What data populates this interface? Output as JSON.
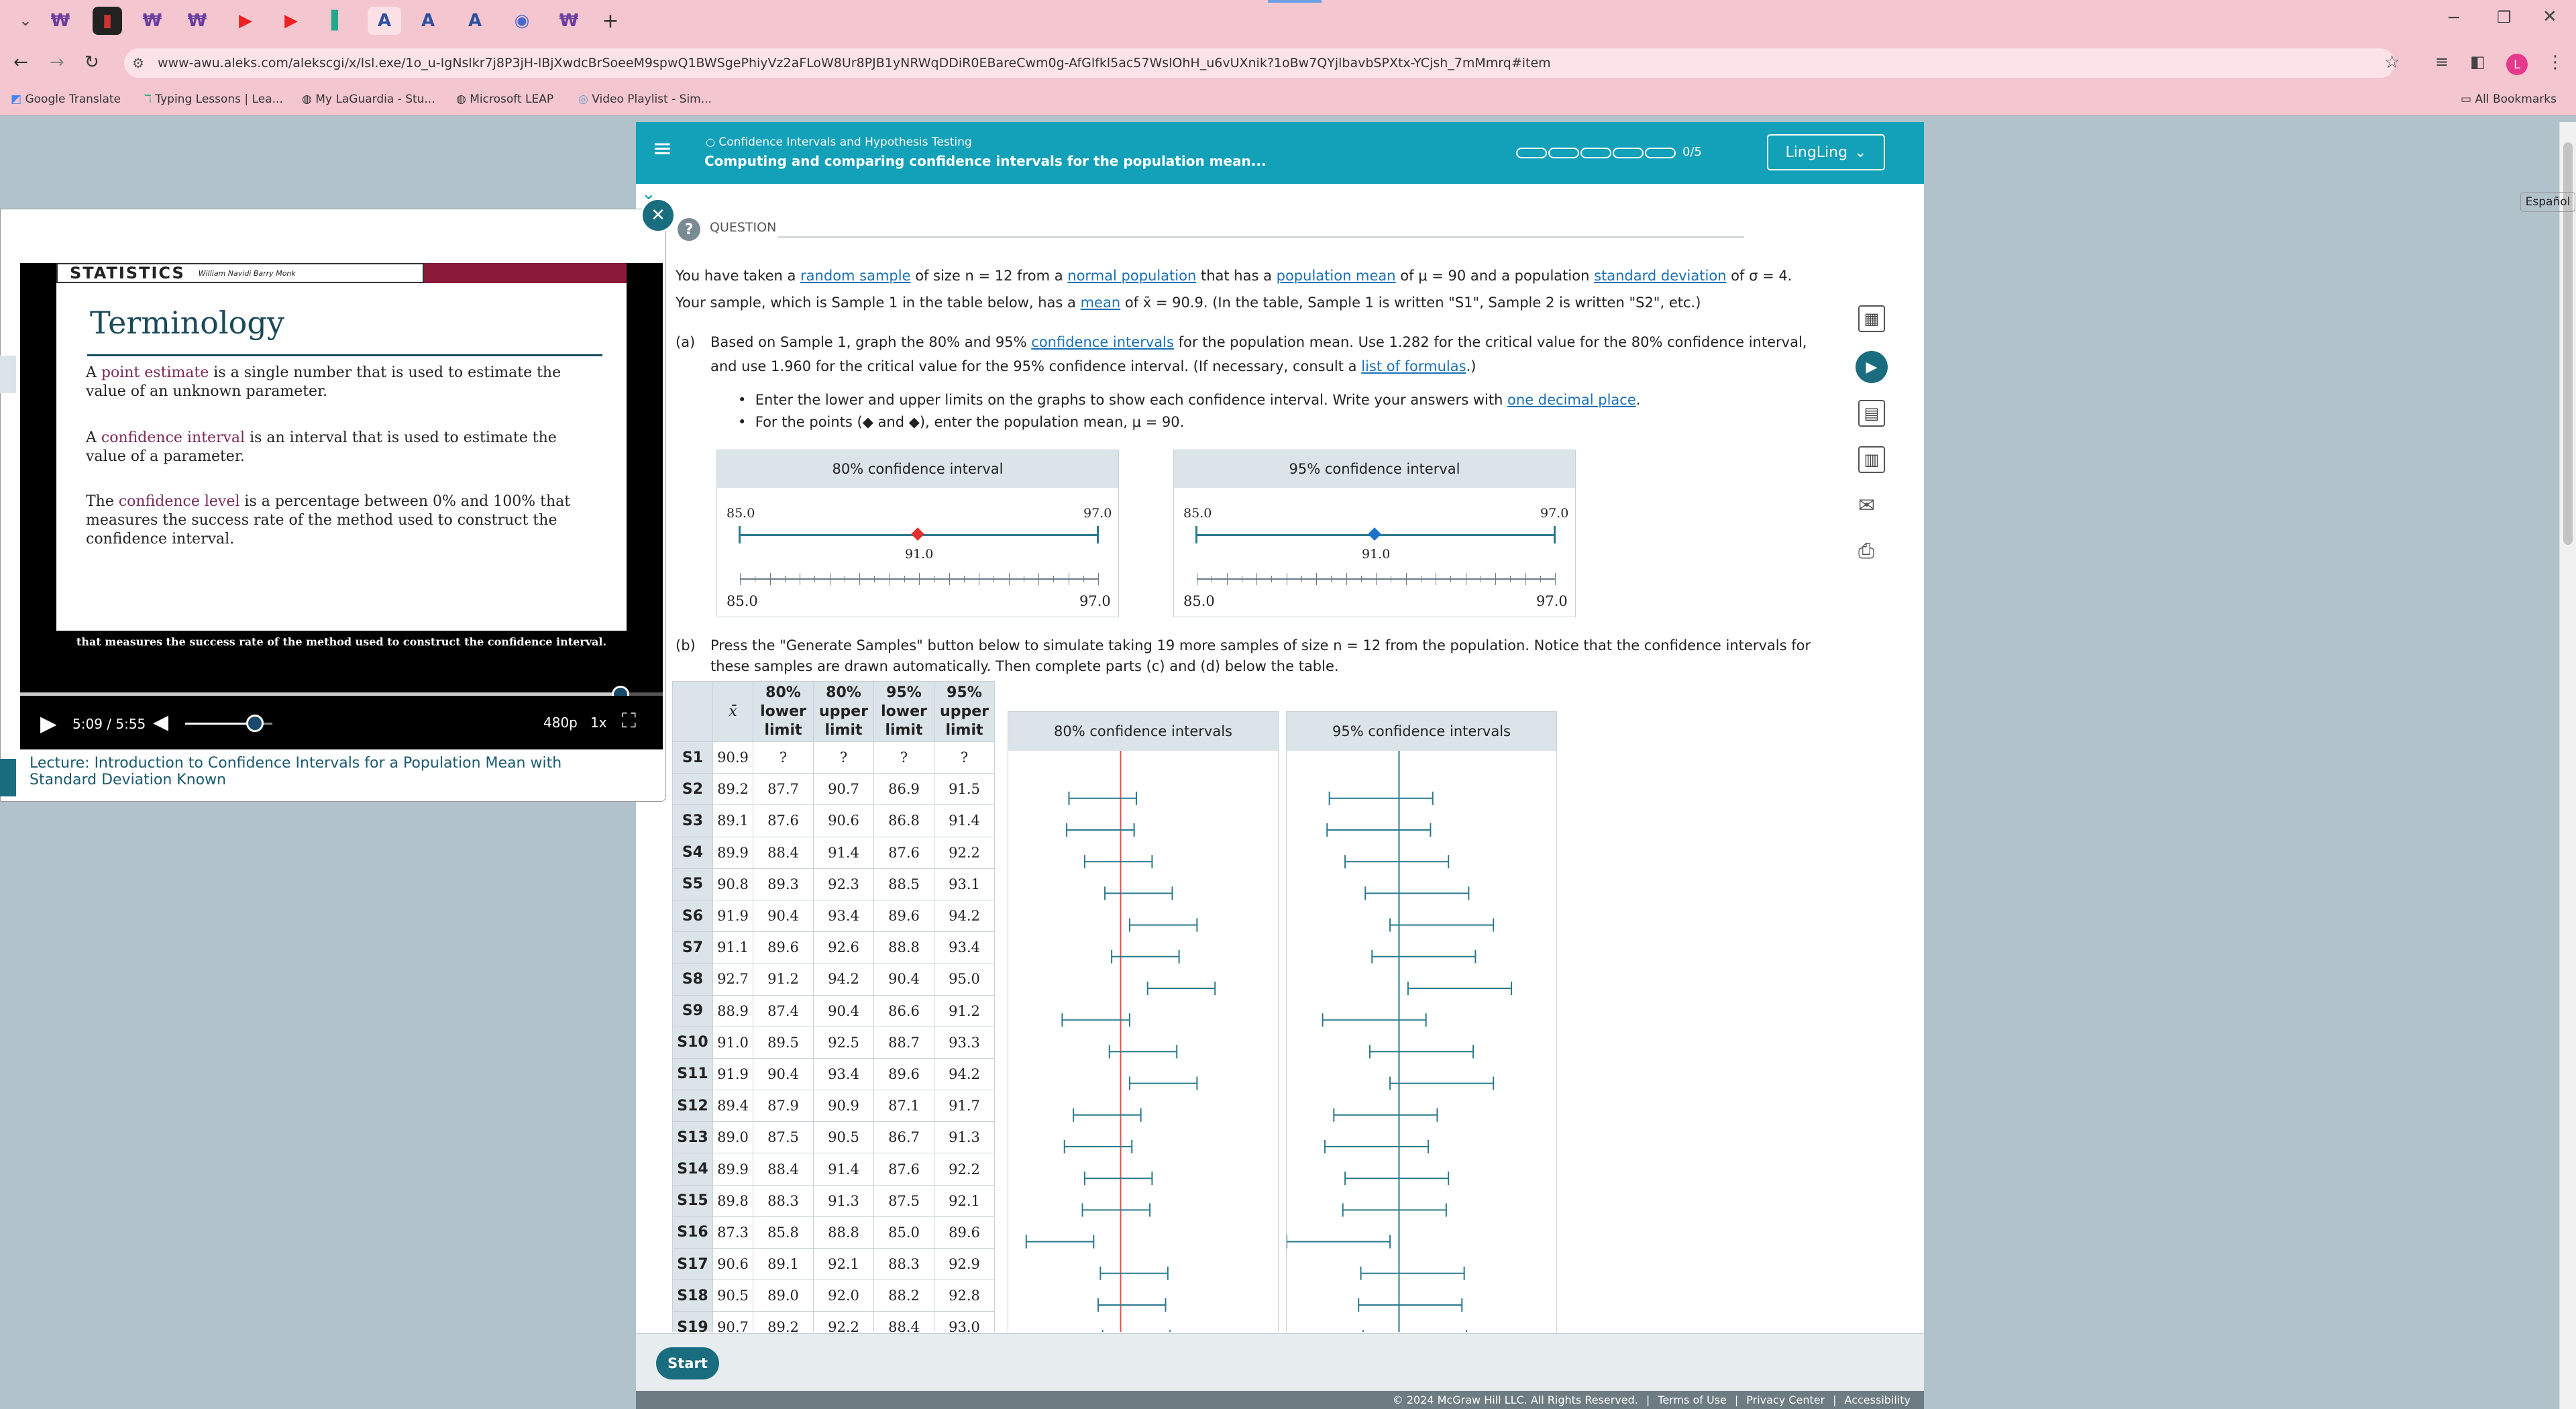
{
  "browser": {
    "url": "www-awu.aleks.com/alekscgi/x/Isl.exe/1o_u-IgNslkr7j8P3jH-lBjXwdcBrSoeeM9spwQ1BWSgePhiyVz2aFLoW8Ur8PJB1yNRWqDDiR0EBareCwm0g-AfGlfkl5ac57WslOhH_u6vUXnik?1oBw7QYjlbavbSPXtx-YCjsh_7mMmrq#item",
    "bookmarks": [
      "Google Translate",
      "Typing Lessons | Lea...",
      "My LaGuardia - Stu...",
      "Microsoft LEAP",
      "Video Playlist - Sim..."
    ],
    "all_bookmarks": "All Bookmarks",
    "profile_initial": "L",
    "tab_letters": [
      "A",
      "A",
      "A"
    ]
  },
  "video": {
    "book_title": "STATISTICS",
    "authors": "William Navidi  Barry Monk",
    "slide_heading": "Terminology",
    "slide_p1_a": "A ",
    "slide_p1_term": "point estimate",
    "slide_p1_b": " is a single number that is used to estimate the value of an unknown parameter.",
    "slide_p2_a": "A ",
    "slide_p2_term": "confidence interval",
    "slide_p2_b": " is an interval that is used to estimate the value of a parameter.",
    "slide_p3_a": "The ",
    "slide_p3_term": "confidence level",
    "slide_p3_b": " is a percentage between 0% and 100% that measures the success rate of the method used to construct the confidence interval.",
    "caption": "that measures the success rate of the method used to construct the confidence interval.",
    "time": "5:09 / 5:55",
    "quality": "480p",
    "speed": "1x",
    "progress": 0.934,
    "volume": 0.8,
    "lecture_title": "Lecture: Introduction to Confidence Intervals for a Population Mean with Standard Deviation Known"
  },
  "header": {
    "topic": "Confidence Intervals and Hypothesis Testing",
    "subtitle": "Computing and comparing confidence intervals for the population mean...",
    "progress_text": "0/5",
    "user": "LingLing",
    "espanol": "Español",
    "question_label": "QUESTION"
  },
  "question": {
    "intro1": [
      "You have taken a ",
      "random sample",
      " of size n = 12 from a ",
      "normal population",
      " that has a ",
      "population mean",
      " of μ = 90 and a population ",
      "standard deviation",
      " of σ = 4."
    ],
    "intro2": [
      "Your sample, which is Sample 1 in the table below, has a ",
      "mean",
      " of x̄ = 90.9. (In the table, Sample 1 is written \"S1\", Sample 2 is written \"S2\", etc.)"
    ],
    "a_label": "(a)",
    "a1": [
      "Based on Sample 1, graph the 80% and 95% ",
      "confidence intervals",
      " for the population mean. Use 1.282 for the critical value for the 80% confidence interval,"
    ],
    "a2": [
      "and use 1.960 for the critical value for the 95% confidence interval. (If necessary, consult a ",
      "list of formulas",
      ".)"
    ],
    "bullet1": [
      "Enter the lower and upper limits on the graphs to show each confidence interval. Write your answers with ",
      "one decimal place",
      "."
    ],
    "bullet2": "For the points (◆ and ◆), enter the population mean, μ = 90.",
    "b_label": "(b)",
    "b1": "Press the \"Generate Samples\" button below to simulate taking 19 more samples of size n = 12 from the population. Notice that the confidence intervals for",
    "b2": "these samples are drawn automatically. Then complete parts (c) and (d) below the table."
  },
  "graph80": {
    "title": "80% confidence interval",
    "left": "85.0",
    "right": "97.0",
    "mid": "91.0",
    "axis_left": "85.0",
    "axis_right": "97.0"
  },
  "graph95": {
    "title": "95% confidence interval",
    "left": "85.0",
    "right": "97.0",
    "mid": "91.0",
    "axis_left": "85.0",
    "axis_right": "97.0"
  },
  "table": {
    "headers": [
      "x̄",
      "80% lower limit",
      "80% upper limit",
      "95% lower limit",
      "95% upper limit"
    ],
    "col80": "80% confidence intervals",
    "col95": "95% confidence intervals",
    "mu": 90,
    "xmin": 85,
    "xmax": 97,
    "rows": [
      [
        "S1",
        "90.9",
        "?",
        "?",
        "?",
        "?"
      ],
      [
        "S2",
        "89.2",
        "87.7",
        "90.7",
        "86.9",
        "91.5"
      ],
      [
        "S3",
        "89.1",
        "87.6",
        "90.6",
        "86.8",
        "91.4"
      ],
      [
        "S4",
        "89.9",
        "88.4",
        "91.4",
        "87.6",
        "92.2"
      ],
      [
        "S5",
        "90.8",
        "89.3",
        "92.3",
        "88.5",
        "93.1"
      ],
      [
        "S6",
        "91.9",
        "90.4",
        "93.4",
        "89.6",
        "94.2"
      ],
      [
        "S7",
        "91.1",
        "89.6",
        "92.6",
        "88.8",
        "93.4"
      ],
      [
        "S8",
        "92.7",
        "91.2",
        "94.2",
        "90.4",
        "95.0"
      ],
      [
        "S9",
        "88.9",
        "87.4",
        "90.4",
        "86.6",
        "91.2"
      ],
      [
        "S10",
        "91.0",
        "89.5",
        "92.5",
        "88.7",
        "93.3"
      ],
      [
        "S11",
        "91.9",
        "90.4",
        "93.4",
        "89.6",
        "94.2"
      ],
      [
        "S12",
        "89.4",
        "87.9",
        "90.9",
        "87.1",
        "91.7"
      ],
      [
        "S13",
        "89.0",
        "87.5",
        "90.5",
        "86.7",
        "91.3"
      ],
      [
        "S14",
        "89.9",
        "88.4",
        "91.4",
        "87.6",
        "92.2"
      ],
      [
        "S15",
        "89.8",
        "88.3",
        "91.3",
        "87.5",
        "92.1"
      ],
      [
        "S16",
        "87.3",
        "85.8",
        "88.8",
        "85.0",
        "89.6"
      ],
      [
        "S17",
        "90.6",
        "89.1",
        "92.1",
        "88.3",
        "92.9"
      ],
      [
        "S18",
        "90.5",
        "89.0",
        "92.0",
        "88.2",
        "92.8"
      ],
      [
        "S19",
        "90.7",
        "89.2",
        "92.2",
        "88.4",
        "93.0"
      ]
    ]
  },
  "start_button": "Start",
  "footer": [
    "© 2024 McGraw Hill LLC. All Rights Reserved.",
    "Terms of Use",
    "Privacy Center",
    "Accessibility"
  ],
  "colors": {
    "teal": "#13a0b9",
    "ci": "#2a7a8c",
    "mu_line": "#e84b4b",
    "red_point": "#e03131",
    "blue_point": "#1a73c8"
  }
}
